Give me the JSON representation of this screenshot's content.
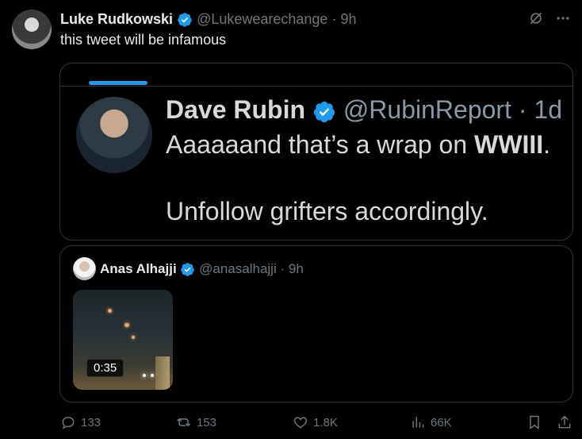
{
  "tweet": {
    "author_name": "Luke Rudkowski",
    "author_handle": "@Lukewearechange",
    "separator": "·",
    "time": "9h",
    "text": "this tweet will be infamous"
  },
  "screenshot": {
    "name": "Dave Rubin",
    "handle": "@RubinReport",
    "separator": "·",
    "time": "1d",
    "line1_prefix": "Aaaaaand that’s a wrap on ",
    "line1_bold": "WWIII",
    "line1_suffix": ".",
    "line2": "Unfollow grifters accordingly."
  },
  "quote": {
    "name": "Anas Alhajji",
    "handle": "@anasalhajji",
    "separator": "·",
    "time": "9h",
    "video_duration": "0:35"
  },
  "actions": {
    "replies": "133",
    "reposts": "153",
    "likes": "1.8K",
    "views": "66K"
  },
  "colors": {
    "verified": "#1d9bf0",
    "muted": "#71767b",
    "border": "#2f3336"
  }
}
